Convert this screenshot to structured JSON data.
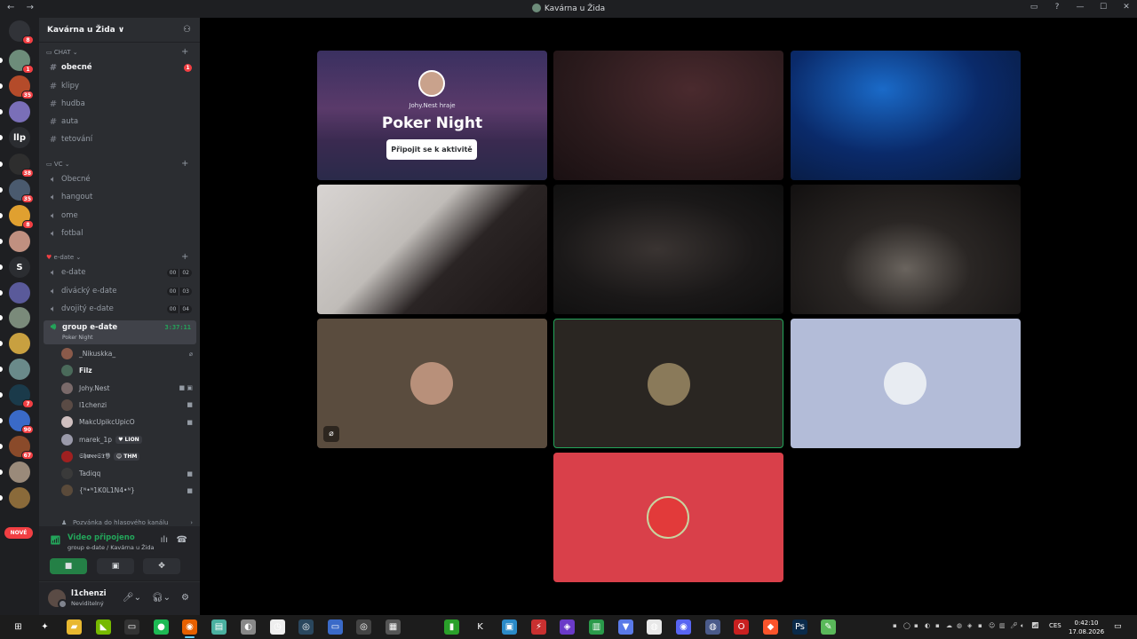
{
  "window": {
    "title": "Kavárna u Žida",
    "nav": [
      "←",
      "→"
    ],
    "controls": [
      "▭",
      "?",
      "—",
      "☐",
      "✕"
    ]
  },
  "servers": {
    "items": [
      {
        "name": "discord-home",
        "label": "",
        "badge": "8",
        "color": "#313338"
      },
      {
        "name": "server-1",
        "label": "",
        "badge": "1",
        "color": "#6d8c7a"
      },
      {
        "name": "server-2",
        "label": "",
        "badge": "35",
        "color": "#b44b2a"
      },
      {
        "name": "server-3",
        "label": "",
        "badge": "",
        "color": "#7a6fb8"
      },
      {
        "name": "server-llp",
        "label": "llp",
        "badge": "",
        "color": "#2b2d31"
      },
      {
        "name": "server-5",
        "label": "",
        "badge": "38",
        "color": "#2e2e2e"
      },
      {
        "name": "server-6",
        "label": "",
        "badge": "35",
        "color": "#4a5a6e"
      },
      {
        "name": "server-7",
        "label": "",
        "badge": "8",
        "color": "#e0a030"
      },
      {
        "name": "server-8",
        "label": "",
        "badge": "",
        "color": "#c09080"
      },
      {
        "name": "server-s",
        "label": "S",
        "badge": "",
        "color": "#2b2d31"
      },
      {
        "name": "server-10",
        "label": "",
        "badge": "",
        "color": "#5a5a9a"
      },
      {
        "name": "server-11",
        "label": "",
        "badge": "",
        "color": "#7a8a7a"
      },
      {
        "name": "server-12",
        "label": "",
        "badge": "",
        "color": "#c8a040"
      },
      {
        "name": "server-13",
        "label": "",
        "badge": "",
        "color": "#6a8a8a"
      },
      {
        "name": "server-14",
        "label": "",
        "badge": "7",
        "color": "#1a3a4a"
      },
      {
        "name": "server-15",
        "label": "",
        "badge": "90",
        "color": "#3a6ac8"
      },
      {
        "name": "server-16",
        "label": "",
        "badge": "67",
        "color": "#8a4a2a"
      },
      {
        "name": "server-17",
        "label": "",
        "badge": "",
        "color": "#9a8a7a"
      },
      {
        "name": "server-18",
        "label": "",
        "badge": "",
        "color": "#8a6a3a"
      }
    ],
    "new_label": "NOVÉ"
  },
  "guild": {
    "name": "Kavárna u Žida ∨"
  },
  "categories": [
    {
      "name": "CHAT ⌄",
      "channels": [
        {
          "label": "obecné",
          "bright": true,
          "unread": "1"
        },
        {
          "label": "klipy"
        },
        {
          "label": "hudba"
        },
        {
          "label": "auta"
        },
        {
          "label": "tetování"
        }
      ]
    },
    {
      "name": "VC ⌄",
      "channels": [
        {
          "label": "Obecné"
        },
        {
          "label": "hangout"
        },
        {
          "label": "ome"
        },
        {
          "label": "fotbal"
        }
      ]
    },
    {
      "name": "e-date ⌄",
      "channels": [
        {
          "label": "e-date",
          "c1": "00",
          "c2": "02"
        },
        {
          "label": "divácký e-date",
          "c1": "00",
          "c2": "03"
        },
        {
          "label": "dvojitý e-date",
          "c1": "00",
          "c2": "04"
        }
      ]
    }
  ],
  "active_channel": {
    "label": "group e-date",
    "sub": "Poker Night",
    "timer": "3:37:11"
  },
  "members": [
    {
      "name": "_Nikuskka_",
      "bold": false,
      "tag": "",
      "icons": "⌀",
      "color": "#8a5a4a"
    },
    {
      "name": "Filz",
      "bold": true,
      "tag": "",
      "icons": "",
      "color": "#4a6a5a"
    },
    {
      "name": "Johy.Nest",
      "bold": false,
      "tag": "",
      "icons": "■ ▣",
      "color": "#7a6a6a"
    },
    {
      "name": "l1chenzi",
      "bold": false,
      "tag": "",
      "icons": "■",
      "color": "#5a4b45"
    },
    {
      "name": "MakcUpikcUpicO",
      "bold": false,
      "tag": "",
      "icons": "■",
      "color": "#d0c0c0"
    },
    {
      "name": "marek_1p",
      "bold": false,
      "tag": "♥ LION",
      "icons": "",
      "color": "#9a9aaa"
    },
    {
      "name": "𝕾𝖍𝖜𝖊𝖊𝕾𝕿𝖄",
      "bold": false,
      "tag": "☺ THM",
      "icons": "",
      "color": "#a02020"
    },
    {
      "name": "Tadiqq",
      "bold": false,
      "tag": "",
      "icons": "■",
      "color": "#3a3a3a"
    },
    {
      "name": "{ᴺ•ᴺ1K0L1N4•ᴺ}",
      "bold": false,
      "tag": "",
      "icons": "■",
      "color": "#5a4a3a"
    }
  ],
  "invite_text": "Pozvánka do hlasového kanálu",
  "voice": {
    "status": "Video připojeno",
    "where": "group e-date / Kavárna u Žida"
  },
  "user": {
    "name": "l1chenzi",
    "status": "Neviditelný"
  },
  "activity": {
    "host": "Johy.Nest hraje",
    "name": "Poker Night",
    "button": "Připojit se k aktivitě"
  },
  "taskbar": {
    "clock_time": "0:42:10",
    "clock_date": "17.08.2026",
    "lang": "CES"
  }
}
